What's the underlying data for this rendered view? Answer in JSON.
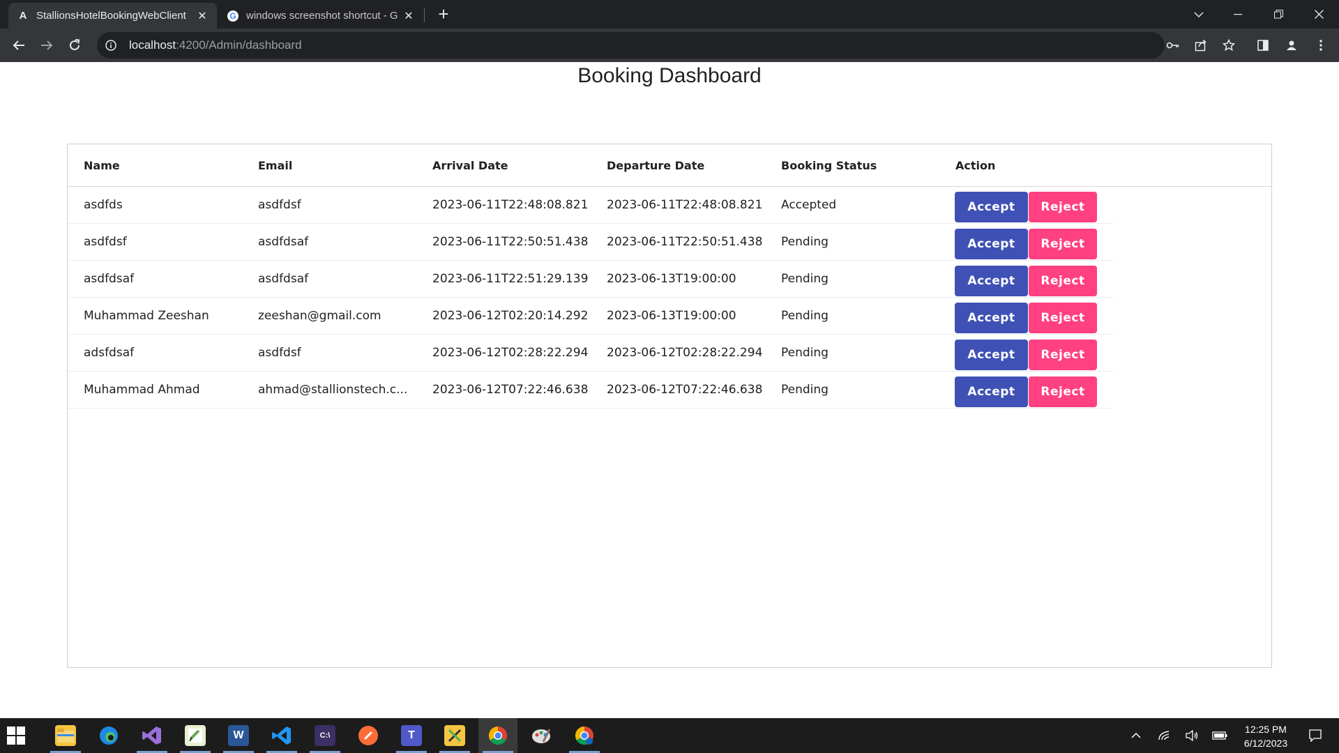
{
  "browser": {
    "tabs": [
      {
        "title": "StallionsHotelBookingWebClient",
        "favicon": "angular-icon",
        "active": true
      },
      {
        "title": "windows screenshot shortcut - G",
        "favicon": "google-icon",
        "active": false
      }
    ],
    "url_host": "localhost",
    "url_path": ":4200/Admin/dashboard"
  },
  "page": {
    "title": "Booking Dashboard",
    "columns": [
      "Name",
      "Email",
      "Arrival Date",
      "Departure Date",
      "Booking Status",
      "Action"
    ],
    "rows": [
      {
        "name": "asdfds",
        "email": "asdfdsf",
        "arrival": "2023-06-11T22:48:08.821",
        "departure": "2023-06-11T22:48:08.821",
        "status": "Accepted"
      },
      {
        "name": "asdfdsf",
        "email": "asdfdsaf",
        "arrival": "2023-06-11T22:50:51.438",
        "departure": "2023-06-11T22:50:51.438",
        "status": "Pending"
      },
      {
        "name": "asdfdsaf",
        "email": "asdfdsaf",
        "arrival": "2023-06-11T22:51:29.139",
        "departure": "2023-06-13T19:00:00",
        "status": "Pending"
      },
      {
        "name": "Muhammad Zeeshan",
        "email": "zeeshan@gmail.com",
        "arrival": "2023-06-12T02:20:14.292",
        "departure": "2023-06-13T19:00:00",
        "status": "Pending"
      },
      {
        "name": "adsfdsaf",
        "email": "asdfdsf",
        "arrival": "2023-06-12T02:28:22.294",
        "departure": "2023-06-12T02:28:22.294",
        "status": "Pending"
      },
      {
        "name": "Muhammad Ahmad",
        "email": "ahmad@stallionstech.c...",
        "arrival": "2023-06-12T07:22:46.638",
        "departure": "2023-06-12T07:22:46.638",
        "status": "Pending"
      }
    ],
    "accept_label": "Accept",
    "reject_label": "Reject",
    "colors": {
      "accept": "#3f51b5",
      "reject": "#ff4081"
    }
  },
  "taskbar": {
    "time": "12:25 PM",
    "date": "6/12/2023",
    "apps": [
      "file-explorer-icon",
      "edge-icon",
      "visual-studio-icon",
      "notepad-plus-icon",
      "word-icon",
      "vscode-icon",
      "terminal-icon",
      "postman-icon",
      "teams-icon",
      "sticky-tools-icon",
      "chrome-icon",
      "paint-icon",
      "chrome-profile-icon"
    ]
  }
}
